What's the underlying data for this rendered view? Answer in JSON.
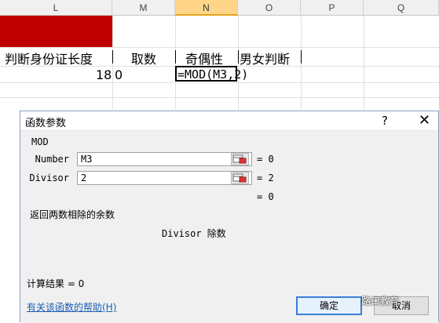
{
  "columns": [
    "L",
    "M",
    "N",
    "O",
    "P",
    "Q"
  ],
  "active_column": "N",
  "cells": {
    "header_l": "判断身份证长度",
    "header_m": "取数",
    "header_n": "奇偶性",
    "header_o": "男女判断",
    "value_l": "18",
    "value_m": "0",
    "formula_n": "=MOD(M3,2)"
  },
  "dialog": {
    "title": "函数参数",
    "help_icon": "?",
    "close_icon": "✕",
    "function_name": "MOD",
    "args": [
      {
        "label": "Number",
        "value": "M3",
        "result": "= 0"
      },
      {
        "label": "Divisor",
        "value": "2",
        "result": "= 2"
      }
    ],
    "overall_result": "= 0",
    "description": "返回两数相除的余数",
    "param_description": "Divisor  除数",
    "calc_result": "计算结果 =   0",
    "help_link": "有关该函数的帮助(H)",
    "ok_label": "确定",
    "cancel_label": "取消"
  },
  "watermark": "路口教育"
}
